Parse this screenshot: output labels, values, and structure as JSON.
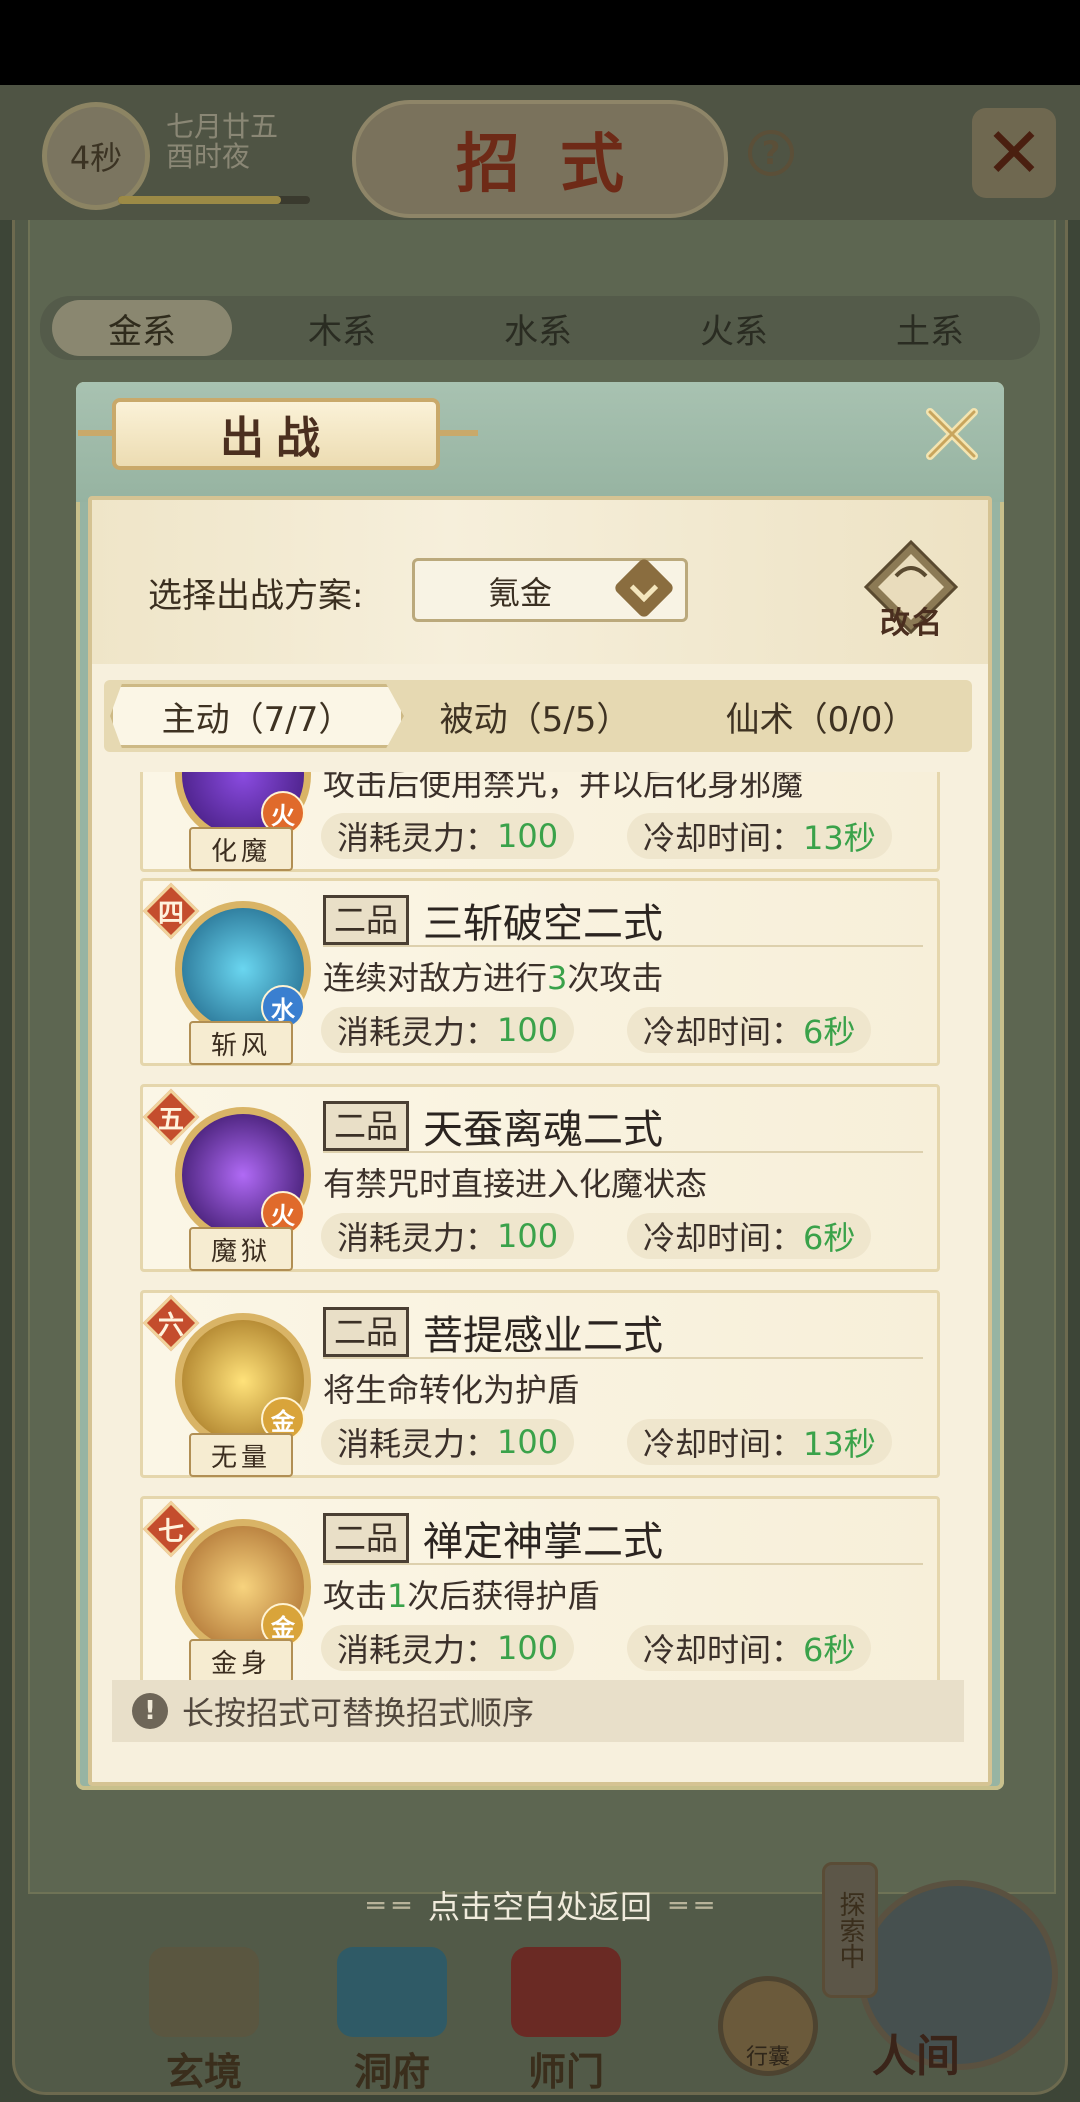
{
  "header": {
    "timer": "4秒",
    "date_line1": "七月廿五",
    "date_line2": "酉时夜",
    "title": "招式",
    "help": "?"
  },
  "element_tabs": [
    "金系",
    "木系",
    "水系",
    "火系",
    "土系"
  ],
  "modal": {
    "title": "出战",
    "scheme_label": "选择出战方案:",
    "scheme_value": "氪金",
    "rename_label": "改名",
    "sub_tabs": [
      "主动（7/7）",
      "被动（5/5）",
      "仙术（0/0）"
    ],
    "cost_label": "消耗灵力：",
    "cooldown_label": "冷却时间：",
    "skills": [
      {
        "order": "",
        "grade": "",
        "name": "",
        "desc_pre": "攻击后使用禁咒，并以后化身邪魔",
        "desc_num": "",
        "desc_post": "",
        "orb_name": "化魔",
        "element": "火",
        "cost": "100",
        "cooldown": "13秒"
      },
      {
        "order": "四",
        "grade": "二品",
        "name": "三斩破空二式",
        "desc_pre": "连续对敌方进行",
        "desc_num": "3",
        "desc_post": "次攻击",
        "orb_name": "斩风",
        "element": "水",
        "cost": "100",
        "cooldown": "6秒"
      },
      {
        "order": "五",
        "grade": "二品",
        "name": "天蚕离魂二式",
        "desc_pre": "有禁咒时直接进入化魔状态",
        "desc_num": "",
        "desc_post": "",
        "orb_name": "魔狱",
        "element": "火",
        "cost": "100",
        "cooldown": "6秒"
      },
      {
        "order": "六",
        "grade": "二品",
        "name": "菩提感业二式",
        "desc_pre": "将生命转化为护盾",
        "desc_num": "",
        "desc_post": "",
        "orb_name": "无量",
        "element": "金",
        "cost": "100",
        "cooldown": "13秒"
      },
      {
        "order": "七",
        "grade": "二品",
        "name": "禅定神掌二式",
        "desc_pre": "攻击",
        "desc_num": "1",
        "desc_post": "次后获得护盾",
        "orb_name": "金身",
        "element": "金",
        "cost": "100",
        "cooldown": "6秒"
      }
    ],
    "tip": "长按招式可替换招式顺序"
  },
  "footer": {
    "hint": "点击空白处返回",
    "nav": [
      "玄境",
      "洞府",
      "师门"
    ],
    "bag": "行囊",
    "explore": "探索中",
    "world": "人间"
  },
  "colors": {
    "accent_green": "#3aa24a",
    "fire": "#e06a2b",
    "water": "#3a7fd0",
    "metal": "#d9a43a"
  }
}
